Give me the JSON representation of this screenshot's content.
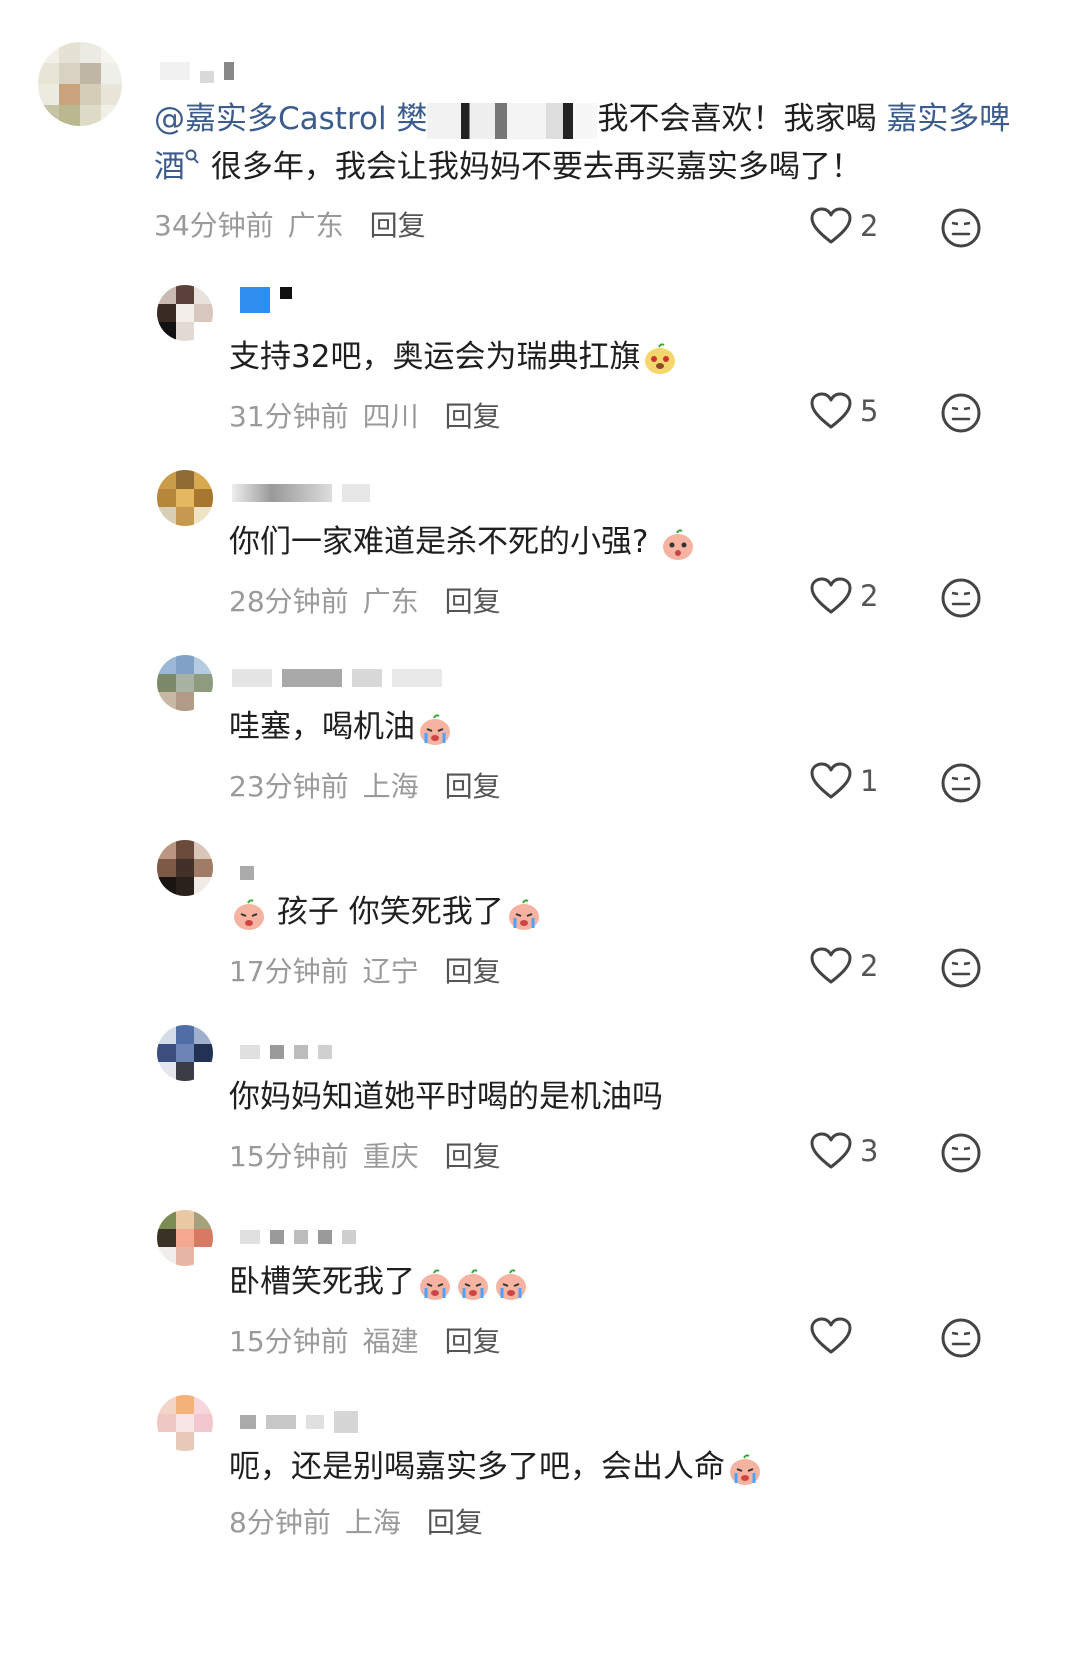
{
  "comments": [
    {
      "text_before": "@嘉实多Castrol 樊",
      "text_after": "我不会喜欢！我家喝 ",
      "link": "嘉实多啤酒",
      "text_end": " 很多年，我会让我妈妈不要去再买嘉实多喝了！",
      "time": "34分钟前",
      "location": "广东",
      "reply": "回复",
      "likes": "2"
    },
    {
      "text": "支持32吧，奥运会为瑞典扛旗",
      "time": "31分钟前",
      "location": "四川",
      "reply": "回复",
      "likes": "5"
    },
    {
      "text": "你们一家难道是杀不死的小强?",
      "time": "28分钟前",
      "location": "广东",
      "reply": "回复",
      "likes": "2"
    },
    {
      "text": "哇塞，喝机油",
      "time": "23分钟前",
      "location": "上海",
      "reply": "回复",
      "likes": "1"
    },
    {
      "text": "孩子 你笑死我了",
      "time": "17分钟前",
      "location": "辽宁",
      "reply": "回复",
      "likes": "2"
    },
    {
      "text": "你妈妈知道她平时喝的是机油吗",
      "time": "15分钟前",
      "location": "重庆",
      "reply": "回复",
      "likes": "3"
    },
    {
      "text": "卧槽笑死我了",
      "time": "15分钟前",
      "location": "福建",
      "reply": "回复",
      "likes": ""
    },
    {
      "text": "呃，还是别喝嘉实多了吧，会出人命",
      "time": "8分钟前",
      "location": "上海",
      "reply": "回复",
      "likes": ""
    }
  ],
  "icons": {
    "like": "heart-outline-icon",
    "dislike": "neutral-face-icon",
    "emoji": "crying-peach-emoji"
  },
  "colors": {
    "mention": "#3d5c8e",
    "meta": "#9a9a9a",
    "text": "#1f1f1f"
  }
}
